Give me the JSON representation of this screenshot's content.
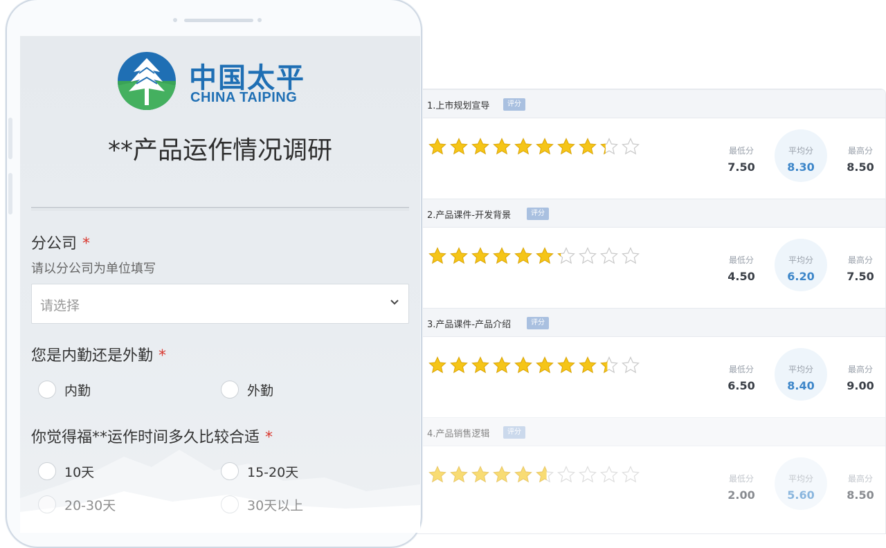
{
  "survey": {
    "logo_cn": "中国太平",
    "logo_en": "CHINA TAIPING",
    "title": "**产品运作情况调研",
    "fields": [
      {
        "label": "分公司",
        "required": "*",
        "hint": "请以分公司为单位填写",
        "select_placeholder": "请选择"
      },
      {
        "label": "您是内勤还是外勤",
        "required": "*",
        "options": [
          "内勤",
          "外勤"
        ]
      },
      {
        "label": "你觉得福**运作时间多久比较合适",
        "required": "*",
        "options": [
          "10天",
          "15-20天",
          "20-30天",
          "30天以上"
        ]
      }
    ]
  },
  "results": {
    "tag": "评分",
    "stat_labels": {
      "min": "最低分",
      "avg": "平均分",
      "max": "最高分"
    },
    "items": [
      {
        "title": "1.上市规划宣导",
        "rating": 8.3,
        "min": "7.50",
        "avg": "8.30",
        "max": "8.50"
      },
      {
        "title": "2.产品课件-开发背景",
        "rating": 6.2,
        "min": "4.50",
        "avg": "6.20",
        "max": "7.50"
      },
      {
        "title": "3.产品课件-产品介绍",
        "rating": 8.4,
        "min": "6.50",
        "avg": "8.40",
        "max": "9.00"
      },
      {
        "title": "4.产品销售逻辑",
        "rating": 5.6,
        "min": "2.00",
        "avg": "5.60",
        "max": "8.50"
      }
    ],
    "max_stars": 10
  },
  "colors": {
    "brand_blue": "#1f6fb4",
    "brand_green": "#4caf50",
    "star_fill": "#f5c518",
    "avg_blue": "#3d86c9",
    "required_red": "#d9382f"
  }
}
